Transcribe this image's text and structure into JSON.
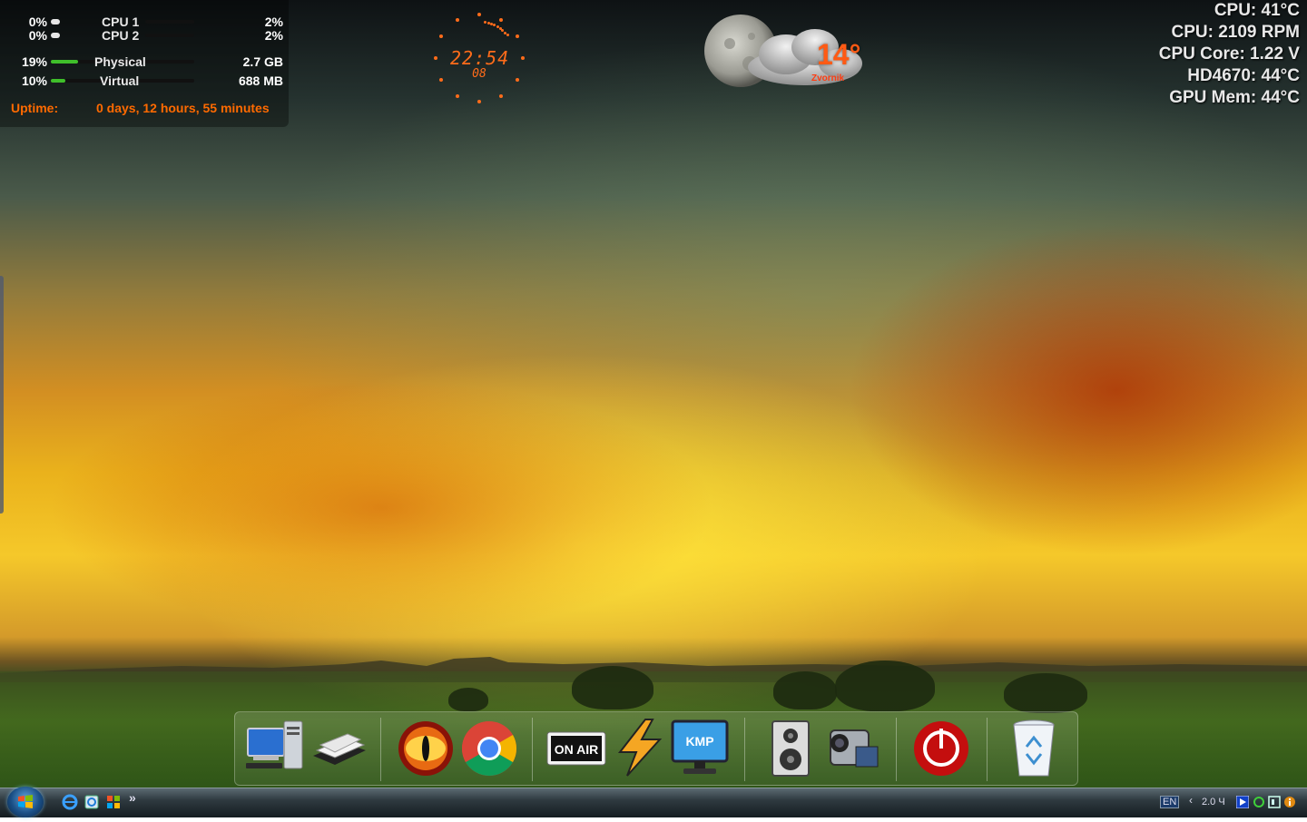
{
  "system_monitor": {
    "cpu1": {
      "label": "CPU 1",
      "left_pct": "0%",
      "right_pct": "2%",
      "level": 0.02
    },
    "cpu2": {
      "label": "CPU 2",
      "left_pct": "0%",
      "right_pct": "2%",
      "level": 0.02
    },
    "physical": {
      "label": "Physical",
      "pct": "19%",
      "value": "2.7 GB",
      "level": 0.19
    },
    "virtual": {
      "label": "Virtual",
      "pct": "10%",
      "value": "688 MB",
      "level": 0.1
    },
    "uptime_label": "Uptime:",
    "uptime_value": "0 days, 12 hours, 55 minutes",
    "accent": "#ff6a00",
    "bar_green": "#3fbf2a"
  },
  "clock": {
    "time": "22:54",
    "date": "08",
    "color": "#ff6c1a"
  },
  "weather": {
    "temp": "14°",
    "location": "Zvornik",
    "icon": "moon-cloud-icon"
  },
  "hardware_monitor": {
    "lines": [
      "CPU: 41°C",
      "CPU: 2109 RPM",
      "CPU Core: 1.22 V",
      "HD4670: 44°C",
      "GPU Mem: 44°C"
    ]
  },
  "dock": {
    "icons": [
      {
        "name": "computer-icon"
      },
      {
        "name": "documents-icon"
      },
      {
        "name": "eye-of-sauron-icon"
      },
      {
        "name": "chrome-icon"
      },
      {
        "name": "on-air-icon",
        "label": "ON AIR"
      },
      {
        "name": "winamp-icon"
      },
      {
        "name": "kmplayer-icon",
        "label": "KMP"
      },
      {
        "name": "speaker-icon"
      },
      {
        "name": "camcorder-icon"
      },
      {
        "name": "power-icon"
      },
      {
        "name": "recycle-bin-icon"
      }
    ]
  },
  "taskbar": {
    "language": "EN",
    "tray_text": "2.0 Ч",
    "quicklaunch": [
      "internet-explorer-icon",
      "ie-window-icon",
      "windows-flag-icon"
    ],
    "overflow": "»"
  }
}
